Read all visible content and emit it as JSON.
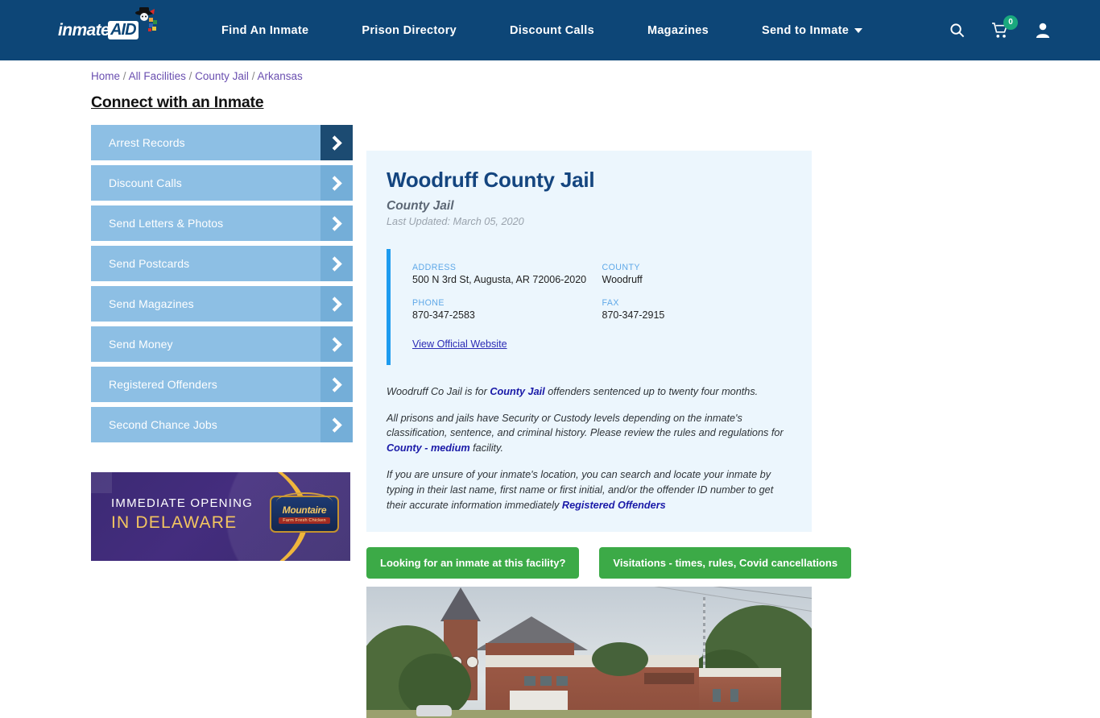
{
  "header": {
    "logo_text": "inmate",
    "logo_accent": "AID",
    "logo_icon": "inmateaid-mascot-logo",
    "nav": [
      {
        "label": "Find An Inmate",
        "name": "nav-find-an-inmate"
      },
      {
        "label": "Prison Directory",
        "name": "nav-prison-directory"
      },
      {
        "label": "Discount Calls",
        "name": "nav-discount-calls"
      },
      {
        "label": "Magazines",
        "name": "nav-magazines"
      },
      {
        "label": "Send to Inmate",
        "name": "nav-send-to-inmate",
        "has_caret": true
      }
    ],
    "icons": {
      "search": "search-icon",
      "cart": "cart-icon",
      "cart_count": "0",
      "account": "user-account-icon"
    },
    "bg_color": "#0d4677",
    "badge_color": "#1aa97e"
  },
  "breadcrumb": {
    "items": [
      "Home",
      "All Facilities",
      "County Jail",
      "Arkansas"
    ],
    "separator": "/"
  },
  "sidebar": {
    "title": "Connect with an Inmate",
    "items": [
      {
        "label": "Arrest Records"
      },
      {
        "label": "Discount Calls"
      },
      {
        "label": "Send Letters & Photos"
      },
      {
        "label": "Send Postcards"
      },
      {
        "label": "Send Magazines"
      },
      {
        "label": "Send Money"
      },
      {
        "label": "Registered Offenders"
      },
      {
        "label": "Second Chance Jobs"
      }
    ],
    "item_color": "#8dbfe4",
    "arrow_color": "#74aed8",
    "arrow_active_color": "#1c4b72"
  },
  "ad": {
    "line1": "IMMEDIATE OPENING",
    "line2": "IN DELAWARE",
    "brand": "Mountaire",
    "brand_sub": "Farm Fresh Chicken",
    "bg_color": "#3c2a74",
    "accent_color": "#f3c560"
  },
  "facility": {
    "title": "Woodruff County Jail",
    "subtitle": "County Jail",
    "last_updated": "Last Updated: March 05, 2020",
    "info": {
      "address_label": "ADDRESS",
      "address_value": "500 N 3rd St, Augusta, AR 72006-2020",
      "county_label": "COUNTY",
      "county_value": "Woodruff",
      "phone_label": "PHONE",
      "phone_value": "870-347-2583",
      "fax_label": "FAX",
      "fax_value": "870-347-2915",
      "website_link": "View Official Website"
    },
    "paragraphs": {
      "p1_a": "Woodruff Co Jail is for ",
      "p1_link": "County Jail",
      "p1_b": " offenders sentenced up to twenty four months.",
      "p2_a": "All prisons and jails have Security or Custody levels depending on the inmate's classification, sentence, and criminal history. Please review the rules and regulations for ",
      "p2_link": "County - medium",
      "p2_b": " facility.",
      "p3_a": "If you are unsure of your inmate's location, you can search and locate your inmate by typing in their last name, first name or first initial, and/or the offender ID number to get their accurate information immediately ",
      "p3_link": "Registered Offenders"
    },
    "cta": [
      {
        "label": "Looking for an inmate at this facility?"
      },
      {
        "label": "Visitations - times, rules, Covid cancellations"
      }
    ],
    "photo_alt": "woodruff-county-jail-building-photo",
    "panel_color": "#ecf6fd",
    "accent_color": "#1d9bef",
    "cta_color": "#3caa47"
  }
}
